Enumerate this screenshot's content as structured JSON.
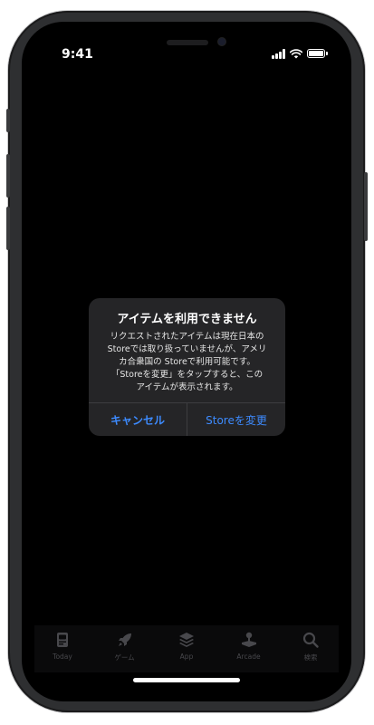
{
  "status_bar": {
    "time": "9:41"
  },
  "alert": {
    "title": "アイテムを利用できません",
    "message": "リクエストされたアイテムは現在日本の\nStoreでは取り扱っていませんが、アメリ\nカ合衆国の Storeで利用可能です。\n「Storeを変更」をタップすると、この\nアイテムが表示されます。",
    "cancel_label": "キャンセル",
    "change_store_label": "Storeを変更"
  },
  "tab_bar": {
    "items": [
      {
        "label": "Today",
        "icon": "today-icon"
      },
      {
        "label": "ゲーム",
        "icon": "rocket-icon"
      },
      {
        "label": "App",
        "icon": "layers-icon"
      },
      {
        "label": "Arcade",
        "icon": "joystick-icon"
      },
      {
        "label": "検索",
        "icon": "search-icon"
      }
    ]
  },
  "colors": {
    "accent": "#3d8bff",
    "screen_bg": "#000000",
    "dialog_bg": "#252527",
    "tab_inactive": "#48484c"
  }
}
